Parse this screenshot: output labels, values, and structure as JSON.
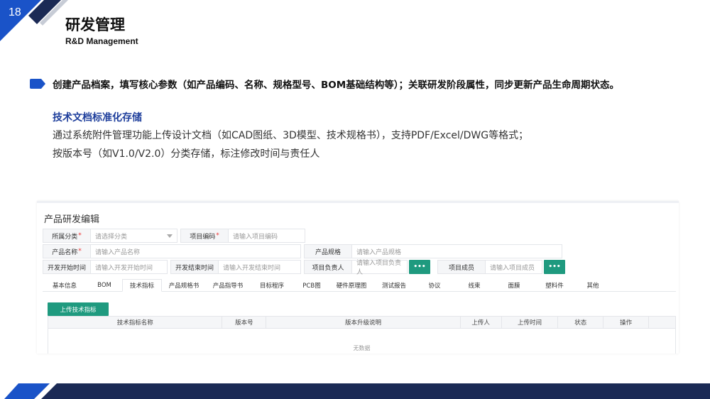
{
  "slide": {
    "page_number": "18",
    "title": "研发管理",
    "subtitle": "R&D Management",
    "bullet": "创建产品档案，填写核心参数（如产品编码、名称、规格型号、BOM基础结构等）；关联研发阶段属性，同步更新产品生命周期状态。",
    "section_heading": "技术文档标准化存储",
    "desc_line1": "通过系统附件管理功能上传设计文档（如CAD图纸、3D模型、技术规格书），支持PDF/Excel/DWG等格式；",
    "desc_line2": "按版本号（如V1.0/V2.0）分类存储，标注修改时间与责任人"
  },
  "colors": {
    "accent_blue": "#1a53c8",
    "dark_navy": "#1b2a55",
    "heading_blue": "#1f3f9c",
    "button_green": "#1f9a7f"
  },
  "app": {
    "panel_title": "产品研发编辑",
    "form": {
      "category": {
        "label": "所属分类",
        "required": "*",
        "placeholder": "请选择分类"
      },
      "project_code": {
        "label": "项目编码",
        "required": "*",
        "placeholder": "请输入项目编码"
      },
      "product_name": {
        "label": "产品名称",
        "required": "*",
        "placeholder": "请输入产品名称"
      },
      "product_spec": {
        "label": "产品规格",
        "placeholder": "请输入产品规格"
      },
      "dev_start": {
        "label": "开发开始时间",
        "placeholder": "请输入开发开始时间"
      },
      "dev_end": {
        "label": "开发结束时间",
        "placeholder": "请输入开发结束时间"
      },
      "project_owner": {
        "label": "项目负责人",
        "placeholder": "请输入项目负责人",
        "button": "•••"
      },
      "project_members": {
        "label": "项目成员",
        "placeholder": "请输入项目成员",
        "button": "•••"
      }
    },
    "tabs": [
      "基本信息",
      "BOM",
      "技术指标",
      "产品规格书",
      "产品指导书",
      "目标程序",
      "PCB图",
      "硬件原理图",
      "测试报告",
      "协议",
      "线束",
      "面膜",
      "塑料件",
      "其他"
    ],
    "active_tab": "技术指标",
    "upload_button": "上传技术指标",
    "table": {
      "columns": [
        "技术指标名称",
        "版本号",
        "版本升级说明",
        "上传人",
        "上传时间",
        "状态",
        "操作"
      ],
      "empty_text": "无数据"
    }
  }
}
